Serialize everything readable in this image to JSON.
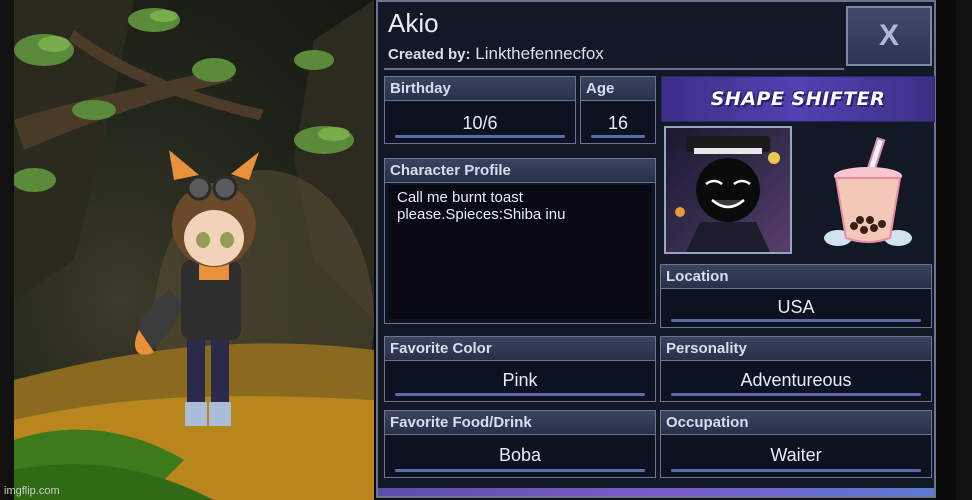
{
  "character": {
    "name": "Akio",
    "created_by_label": "Created by:",
    "creator": "Linkthefennecfox"
  },
  "close_label": "X",
  "fields": {
    "birthday": {
      "label": "Birthday",
      "value": "10/6"
    },
    "age": {
      "label": "Age",
      "value": "16"
    },
    "profile": {
      "label": "Character Profile",
      "value": "Call me burnt toast please.Spieces:Shiba inu"
    },
    "location": {
      "label": "Location",
      "value": "USA"
    },
    "favorite_color": {
      "label": "Favorite Color",
      "value": "Pink"
    },
    "personality": {
      "label": "Personality",
      "value": "Adventureous"
    },
    "favorite_food": {
      "label": "Favorite Food/Drink",
      "value": "Boba"
    },
    "occupation": {
      "label": "Occupation",
      "value": "Waiter"
    }
  },
  "banner_text": "SHAPE SHIFTER",
  "watermark": "imgflip.com",
  "icons": {
    "close": "close-icon",
    "boba": "boba-tea-icon",
    "portrait": "character-portrait"
  },
  "colors": {
    "panel_bg": "#121826",
    "border": "#6b7592",
    "accent": "#5a6da8",
    "banner": "#5042b0"
  }
}
